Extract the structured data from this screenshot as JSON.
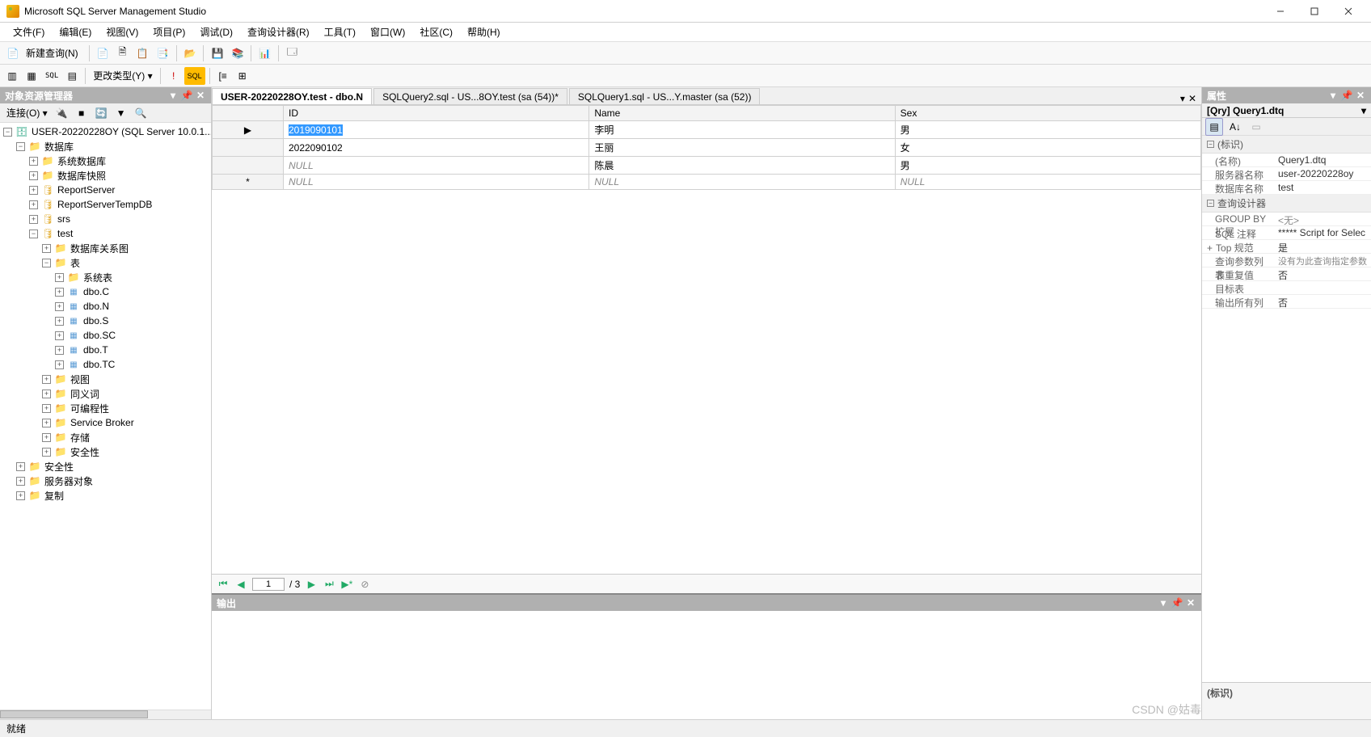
{
  "window": {
    "title": "Microsoft SQL Server Management Studio"
  },
  "menubar": {
    "items": [
      "文件(F)",
      "编辑(E)",
      "视图(V)",
      "项目(P)",
      "调试(D)",
      "查询设计器(R)",
      "工具(T)",
      "窗口(W)",
      "社区(C)",
      "帮助(H)"
    ]
  },
  "toolbar1": {
    "new_query": "新建查询(N)"
  },
  "toolbar2": {
    "change_type": "更改类型(Y) ▾"
  },
  "object_explorer": {
    "title": "对象资源管理器",
    "connect_label": "连接(O) ▾",
    "root": "USER-20220228OY (SQL Server 10.0.1...",
    "databases": "数据库",
    "system_dbs": "系统数据库",
    "db_snapshots": "数据库快照",
    "report_server": "ReportServer",
    "report_server_temp": "ReportServerTempDB",
    "srs": "srs",
    "test": "test",
    "diagrams": "数据库关系图",
    "tables": "表",
    "system_tables": "系统表",
    "table_c": "dbo.C",
    "table_n": "dbo.N",
    "table_s": "dbo.S",
    "table_sc": "dbo.SC",
    "table_t": "dbo.T",
    "table_tc": "dbo.TC",
    "views": "视图",
    "synonyms": "同义词",
    "programmability": "可编程性",
    "service_broker": "Service Broker",
    "storage": "存储",
    "security_db": "安全性",
    "security": "安全性",
    "server_objects": "服务器对象",
    "replication": "复制"
  },
  "tabs": {
    "items": [
      {
        "label": "USER-20220228OY.test - dbo.N",
        "active": true
      },
      {
        "label": "SQLQuery2.sql - US...8OY.test (sa (54))*",
        "active": false
      },
      {
        "label": "SQLQuery1.sql - US...Y.master (sa (52))",
        "active": false
      }
    ]
  },
  "grid": {
    "columns": [
      "ID",
      "Name",
      "Sex"
    ],
    "rows": [
      {
        "marker": "▶",
        "ID": "2019090101",
        "Name": "李明",
        "Sex": "男",
        "selected": true
      },
      {
        "marker": "",
        "ID": "2022090102",
        "Name": "王丽",
        "Sex": "女"
      },
      {
        "marker": "",
        "ID": "NULL",
        "Name": "陈晨",
        "Sex": "男",
        "id_null": true
      },
      {
        "marker": "*",
        "ID": "NULL",
        "Name": "NULL",
        "Sex": "NULL",
        "all_null": true
      }
    ]
  },
  "pager": {
    "current": "1",
    "total": "/ 3"
  },
  "output": {
    "title": "输出"
  },
  "properties": {
    "title": "属性",
    "subject": "[Qry] Query1.dtq",
    "section_id": "(标识)",
    "name_label": "(名称)",
    "name_val": "Query1.dtq",
    "server_label": "服务器名称",
    "server_val": "user-20220228oy",
    "db_label": "数据库名称",
    "db_val": "test",
    "section_designer": "查询设计器",
    "groupby_label": "GROUP BY 扩展",
    "groupby_val": "<无>",
    "sql_comment_label": "SQL 注释",
    "sql_comment_val": "***** Script for Selec",
    "top_label": "Top 规范",
    "top_val": "是",
    "params_label": "查询参数列表",
    "params_val": "没有为此查询指定参数",
    "distinct_label": "非重复值",
    "distinct_val": "否",
    "target_label": "目标表",
    "target_val": "",
    "output_all_label": "输出所有列",
    "output_all_val": "否",
    "desc_title": "(标识)"
  },
  "statusbar": {
    "text": "就绪"
  },
  "watermark": "CSDN @姑毒"
}
